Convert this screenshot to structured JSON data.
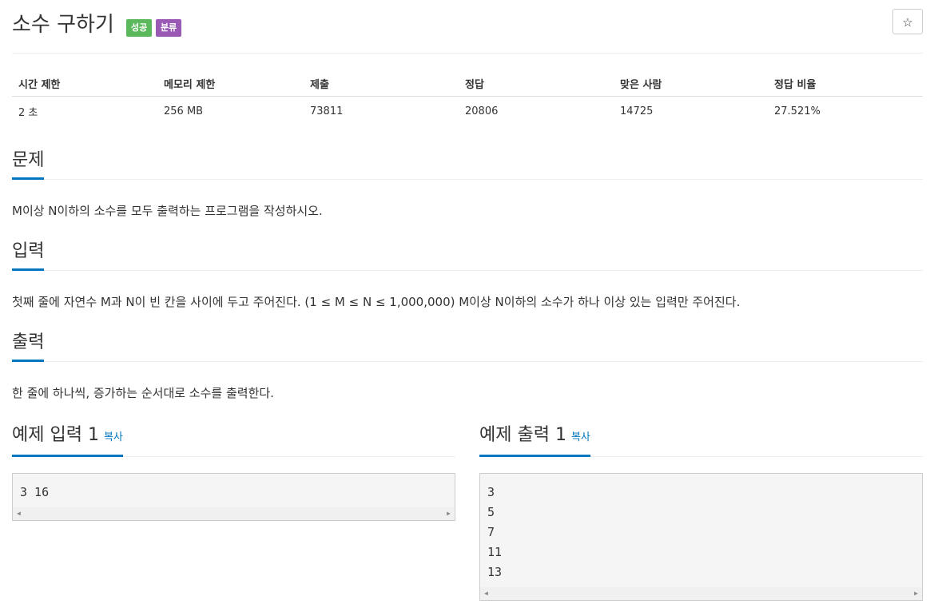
{
  "title": {
    "text": "소수 구하기",
    "badge_success": "성공",
    "badge_class": "분류",
    "star_symbol": "☆"
  },
  "info": {
    "headers": [
      "시간 제한",
      "메모리 제한",
      "제출",
      "정답",
      "맞은 사람",
      "정답 비율"
    ],
    "values": [
      "2 초",
      "256 MB",
      "73811",
      "20806",
      "14725",
      "27.521%"
    ]
  },
  "sections": {
    "problem": {
      "heading": "문제",
      "body": "M이상 N이하의 소수를 모두 출력하는 프로그램을 작성하시오."
    },
    "input": {
      "heading": "입력",
      "body": "첫째 줄에 자연수 M과 N이 빈 칸을 사이에 두고 주어진다. (1 ≤ M ≤ N ≤ 1,000,000) M이상 N이하의 소수가 하나 이상 있는 입력만 주어진다."
    },
    "output": {
      "heading": "출력",
      "body": "한 줄에 하나씩, 증가하는 순서대로 소수를 출력한다."
    }
  },
  "samples": {
    "input": {
      "heading": "예제 입력 1",
      "copy_label": "복사",
      "lines": [
        "3 16"
      ]
    },
    "output": {
      "heading": "예제 출력 1",
      "copy_label": "복사",
      "lines": [
        "3",
        "5",
        "7",
        "11",
        "13"
      ]
    }
  },
  "colors": {
    "accent": "#0076c0",
    "success": "#5cb85c",
    "class": "#9b59b6"
  }
}
